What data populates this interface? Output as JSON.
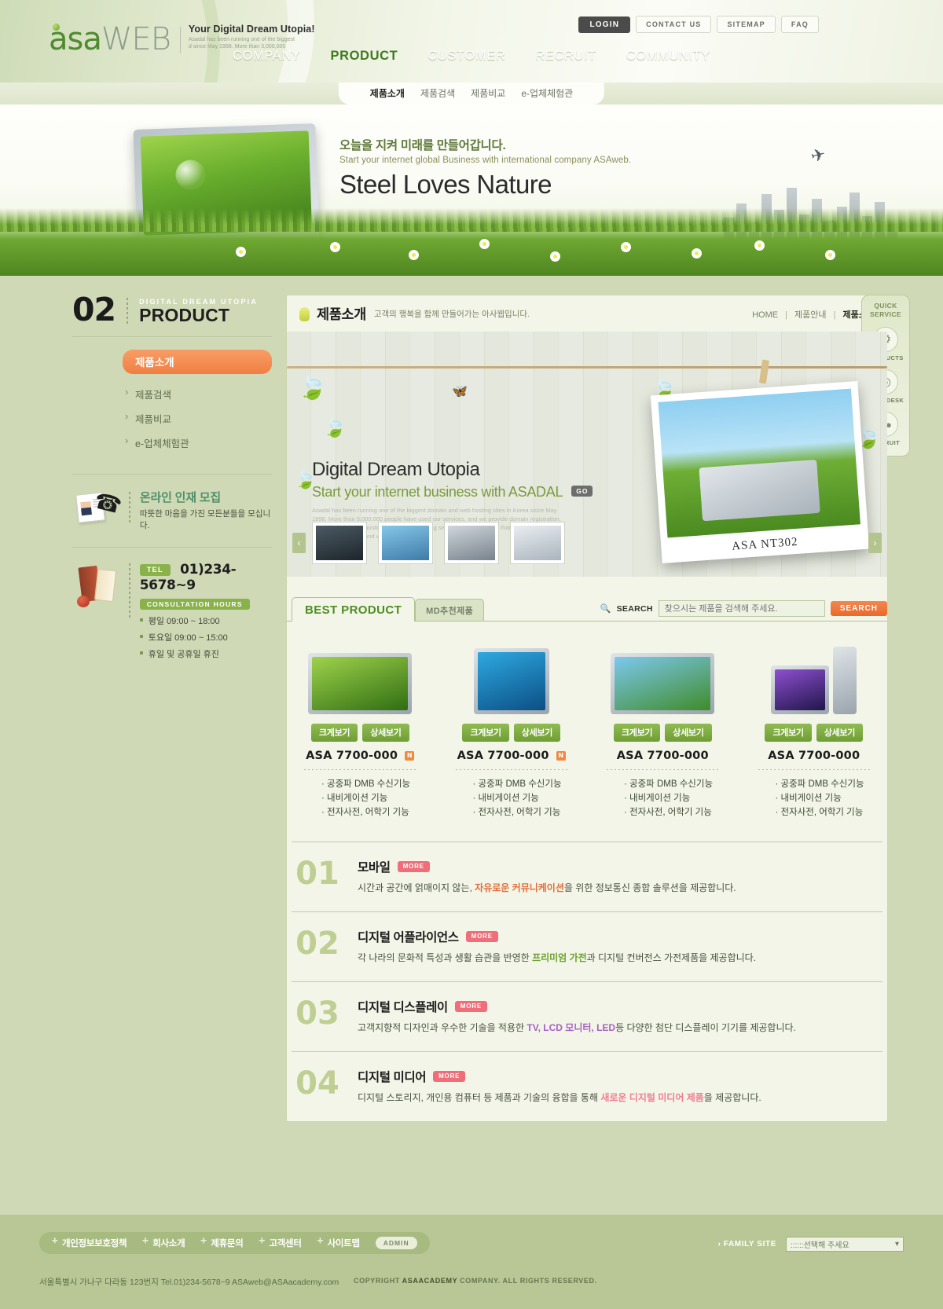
{
  "brand": {
    "name_a": "asa",
    "name_b": "WEB",
    "tagline": "Your Digital Dream Utopia!",
    "tagline_accent": "Utopia!",
    "tagline_sub": "Asadal has been running one of the biggest d since May 1998. More than 3,000,000"
  },
  "topnav": {
    "login": "LOGIN",
    "contact": "CONTACT US",
    "sitemap": "SITEMAP",
    "faq": "FAQ"
  },
  "mainnav": [
    {
      "label": "COMPANY",
      "active": false
    },
    {
      "label": "PRODUCT",
      "active": true
    },
    {
      "label": "CUSTOMER",
      "active": false
    },
    {
      "label": "RECRUIT",
      "active": false
    },
    {
      "label": "COMMUNITY",
      "active": false
    }
  ],
  "subnav": [
    {
      "label": "제품소개",
      "active": true
    },
    {
      "label": "제품검색",
      "active": false
    },
    {
      "label": "제품비교",
      "active": false
    },
    {
      "label": "e-업체체험관",
      "active": false
    }
  ],
  "hero": {
    "kr": "오늘을 지켜 미래를 만들어갑니다.",
    "en": "Start your internet global Business with international company ASAweb.",
    "big": "Steel Loves Nature"
  },
  "sidebar": {
    "number": "02",
    "eyebrow": "DIGITAL DREAM UTOPIA",
    "title": "PRODUCT",
    "nav": [
      {
        "label": "제품소개",
        "active": true
      },
      {
        "label": "제품검색",
        "active": false
      },
      {
        "label": "제품비교",
        "active": false
      },
      {
        "label": "e-업체체험관",
        "active": false
      }
    ],
    "recruit": {
      "title": "온라인 인재 모집",
      "sub": "따뜻한 마음을 가진 모든분들을 모십니다."
    },
    "contact": {
      "tel_tag": "TEL",
      "tel_number": "01)234-5678~9",
      "hours_tag": "CONSULTATION HOURS",
      "hours": [
        "평일 09:00 ~ 18:00",
        "토요일 09:00 ~ 15:00",
        "휴일 및 공휴일 휴진"
      ]
    }
  },
  "panel": {
    "title": "제품소개",
    "subtitle": "고객의 행복을 함께 만들어가는 아사웹입니다.",
    "crumb_home": "HOME",
    "crumb_mid": "제품안내",
    "crumb_cur": "제품소개"
  },
  "banner": {
    "title": "Digital Dream Utopia",
    "subtitle": "Start your internet business with ASADAL",
    "go": "GO",
    "paragraph": "Asadal has been running one of the biggest domain and web hosting sites in Korea since May 1998. More than 3,000,000 people have used our services, and we provide domain registration, web hosting, server hosting, homepage building services. We are proud that we are the best 1 company in domain and web hosting services.",
    "photo_caption": "ASA NT302",
    "prev": "‹",
    "next": "›"
  },
  "tabs": {
    "best": "BEST PRODUCT",
    "md": "MD추천제품"
  },
  "search": {
    "label": "SEARCH",
    "placeholder": "찾으시는 제품을 검색해 주세요.",
    "button": "SEARCH"
  },
  "products": [
    {
      "name": "ASA 7700-000",
      "badge": "N",
      "btn_big": "크게보기",
      "btn_detail": "상세보기",
      "features": [
        "· 공중파 DMB 수신기능",
        "· 내비게이션 기능",
        "· 전자사전, 어학기 기능"
      ],
      "kind": "laptop-green"
    },
    {
      "name": "ASA 7700-000",
      "badge": "N",
      "btn_big": "크게보기",
      "btn_detail": "상세보기",
      "features": [
        "· 공중파 DMB 수신기능",
        "· 내비게이션 기능",
        "· 전자사전, 어학기 기능"
      ],
      "kind": "monitor"
    },
    {
      "name": "ASA 7700-000",
      "badge": "",
      "btn_big": "크게보기",
      "btn_detail": "상세보기",
      "features": [
        "· 공중파 DMB 수신기능",
        "· 내비게이션 기능",
        "· 전자사전, 어학기 기능"
      ],
      "kind": "laptop-sun"
    },
    {
      "name": "ASA 7700-000",
      "badge": "",
      "btn_big": "크게보기",
      "btn_detail": "상세보기",
      "features": [
        "· 공중파 DMB 수신기능",
        "· 내비게이션 기능",
        "· 전자사전, 어학기 기능"
      ],
      "kind": "desktop"
    }
  ],
  "categories": [
    {
      "num": "01",
      "title": "모바일",
      "more": "MORE",
      "desc_pre": "시간과 공간에 얽매이지 않는, ",
      "desc_em": "자유로운 커뮤니케이션",
      "desc_post": "을 위한 정보통신 종합 솔루션을 제공합니다.",
      "em_color": "#e0703c"
    },
    {
      "num": "02",
      "title": "디지털 어플라이언스",
      "more": "MORE",
      "desc_pre": "각 나라의 문화적 특성과 생활 습관을 반영한 ",
      "desc_em": "프리미엄 가전",
      "desc_post": "과 디지털 컨버전스 가전제품을 제공합니다.",
      "em_color": "#6aa02c"
    },
    {
      "num": "03",
      "title": "디지털 디스플레이",
      "more": "MORE",
      "desc_pre": "고객지향적 디자인과 우수한 기술을 적용한 ",
      "desc_em": "TV, LCD 모니터, LED",
      "desc_post": "등 다양한 첨단 디스플레이 기기를 제공합니다.",
      "em_color": "#a661c4"
    },
    {
      "num": "04",
      "title": "디지털 미디어",
      "more": "MORE",
      "desc_pre": "디지털 스토리지, 개인용 컴퓨터 등 제품과 기술의 융합을 통해 ",
      "desc_em": "새로운 디지털 미디어 제품",
      "desc_post": "을 제공합니다.",
      "em_color": "#ee7f92"
    }
  ],
  "quick": {
    "head_line1": "QUICK",
    "head_line2": "SERVICE",
    "items": [
      {
        "label": "PRODUCTS",
        "icon": "gear-icon",
        "glyph": "⚙"
      },
      {
        "label": "HELP DESK",
        "icon": "headset-icon",
        "glyph": "◎"
      },
      {
        "label": "RECRUIT",
        "icon": "people-icon",
        "glyph": "👥"
      }
    ]
  },
  "footer": {
    "links": [
      "개인정보보호정책",
      "회사소개",
      "제휴문의",
      "고객센터",
      "사이트맵"
    ],
    "admin": "ADMIN",
    "family_label": "FAMILY SITE",
    "family_value": "::::::선택해 주세요",
    "address": "서울특별시 가나구 다라동 123번지 Tel.01)234-5678~9 ASAweb@ASAacademy.com",
    "copyright_pre": "COPYRIGHT ",
    "copyright_brand": "ASAACADEMY",
    "copyright_post": " COMPANY.  ALL RIGHTS RESERVED."
  },
  "colors": {
    "accent_orange": "#f07f43",
    "green": "#6f9e34",
    "panel_bg": "#f2f5e7",
    "page_bg": "#cfd9b5"
  }
}
